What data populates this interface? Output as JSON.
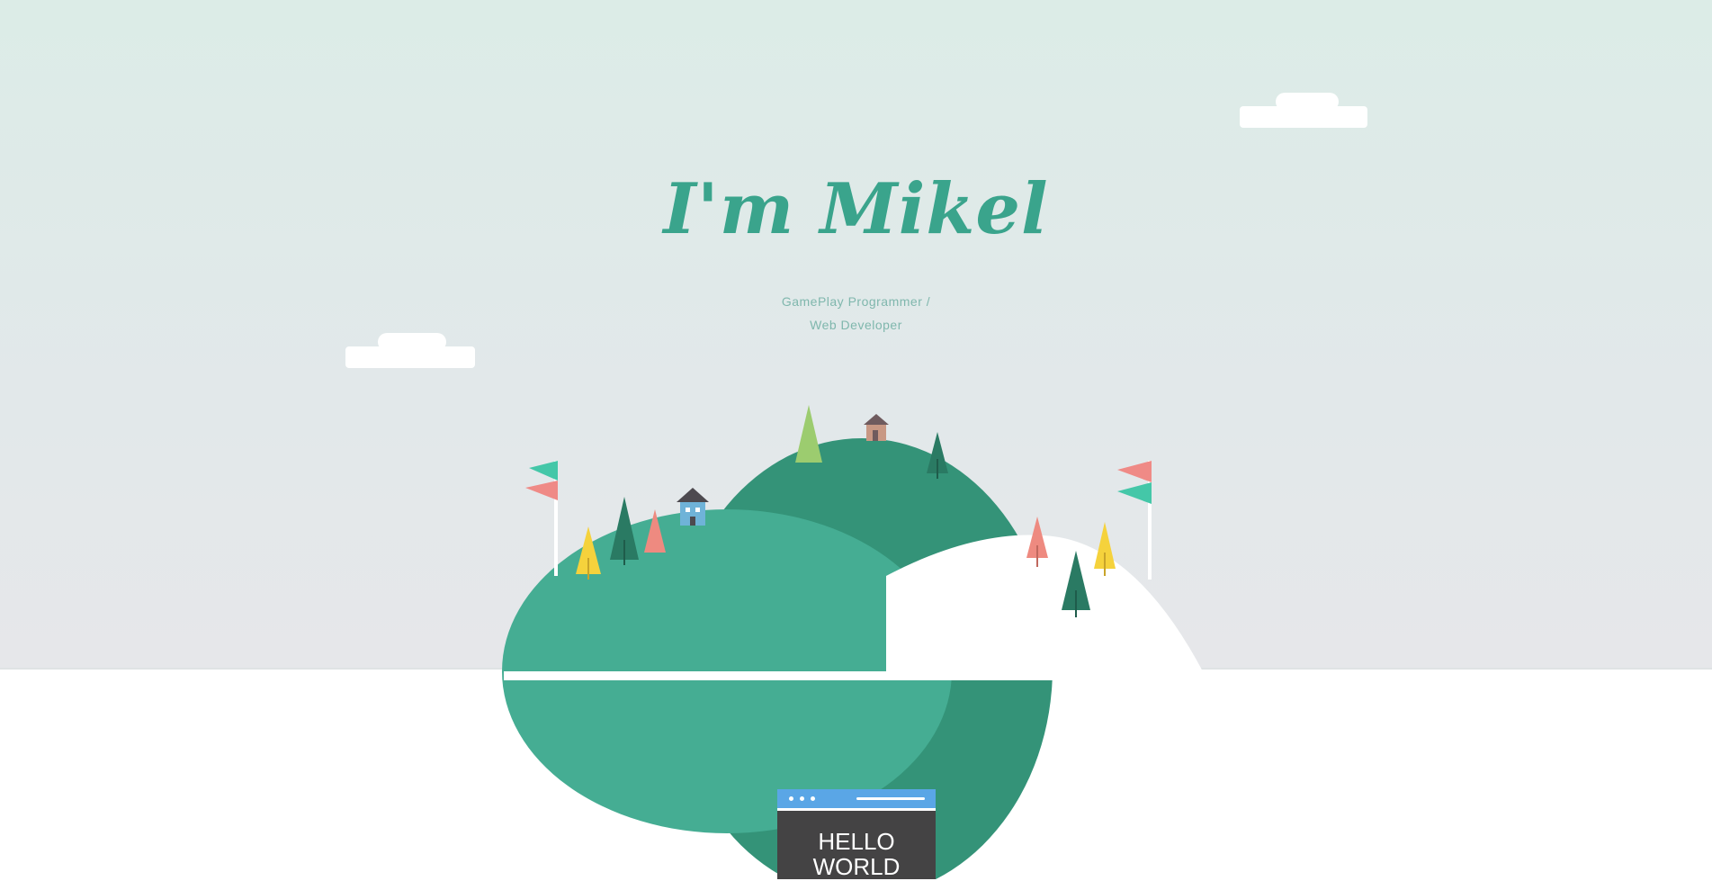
{
  "hero": {
    "title": "I'm Mikel",
    "subtitle_line1": "GamePlay Programmer /",
    "subtitle_line2": "Web Developer"
  },
  "monitor": {
    "line1": "HELLO",
    "line2": "WORLD"
  },
  "colors": {
    "sky": "#dcece7",
    "title": "#3aa48c",
    "hill_front": "#45ad93",
    "hill_back": "#349378",
    "tree_dark": "#2a7a63",
    "tree_pink": "#ee8a80",
    "tree_yellow": "#f5d23c",
    "flag_teal": "#44c7a8",
    "flag_pink": "#ef8a86",
    "monitor_bar": "#5aa6e6",
    "monitor_screen": "#444344"
  }
}
